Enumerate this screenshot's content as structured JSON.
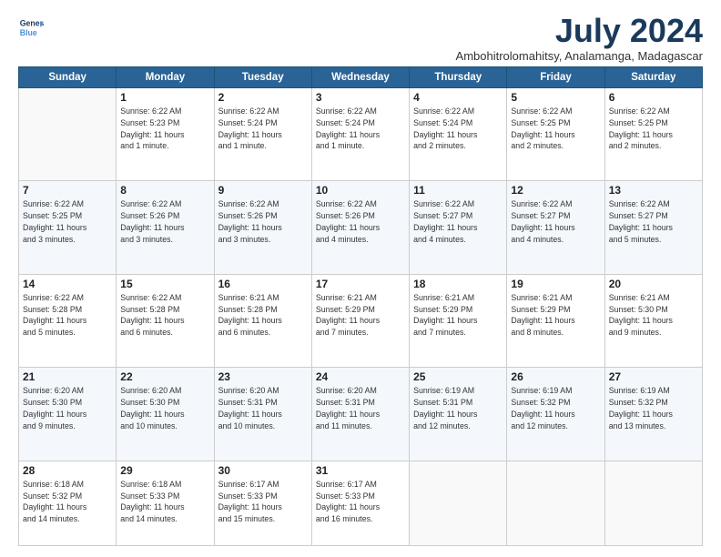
{
  "logo": {
    "line1": "General",
    "line2": "Blue",
    "icon": "▶"
  },
  "title": "July 2024",
  "location": "Ambohitrolomahitsy, Analamanga, Madagascar",
  "days_header": [
    "Sunday",
    "Monday",
    "Tuesday",
    "Wednesday",
    "Thursday",
    "Friday",
    "Saturday"
  ],
  "weeks": [
    [
      {
        "day": "",
        "detail": ""
      },
      {
        "day": "1",
        "detail": "Sunrise: 6:22 AM\nSunset: 5:23 PM\nDaylight: 11 hours\nand 1 minute."
      },
      {
        "day": "2",
        "detail": "Sunrise: 6:22 AM\nSunset: 5:24 PM\nDaylight: 11 hours\nand 1 minute."
      },
      {
        "day": "3",
        "detail": "Sunrise: 6:22 AM\nSunset: 5:24 PM\nDaylight: 11 hours\nand 1 minute."
      },
      {
        "day": "4",
        "detail": "Sunrise: 6:22 AM\nSunset: 5:24 PM\nDaylight: 11 hours\nand 2 minutes."
      },
      {
        "day": "5",
        "detail": "Sunrise: 6:22 AM\nSunset: 5:25 PM\nDaylight: 11 hours\nand 2 minutes."
      },
      {
        "day": "6",
        "detail": "Sunrise: 6:22 AM\nSunset: 5:25 PM\nDaylight: 11 hours\nand 2 minutes."
      }
    ],
    [
      {
        "day": "7",
        "detail": "Sunrise: 6:22 AM\nSunset: 5:25 PM\nDaylight: 11 hours\nand 3 minutes."
      },
      {
        "day": "8",
        "detail": "Sunrise: 6:22 AM\nSunset: 5:26 PM\nDaylight: 11 hours\nand 3 minutes."
      },
      {
        "day": "9",
        "detail": "Sunrise: 6:22 AM\nSunset: 5:26 PM\nDaylight: 11 hours\nand 3 minutes."
      },
      {
        "day": "10",
        "detail": "Sunrise: 6:22 AM\nSunset: 5:26 PM\nDaylight: 11 hours\nand 4 minutes."
      },
      {
        "day": "11",
        "detail": "Sunrise: 6:22 AM\nSunset: 5:27 PM\nDaylight: 11 hours\nand 4 minutes."
      },
      {
        "day": "12",
        "detail": "Sunrise: 6:22 AM\nSunset: 5:27 PM\nDaylight: 11 hours\nand 4 minutes."
      },
      {
        "day": "13",
        "detail": "Sunrise: 6:22 AM\nSunset: 5:27 PM\nDaylight: 11 hours\nand 5 minutes."
      }
    ],
    [
      {
        "day": "14",
        "detail": "Sunrise: 6:22 AM\nSunset: 5:28 PM\nDaylight: 11 hours\nand 5 minutes."
      },
      {
        "day": "15",
        "detail": "Sunrise: 6:22 AM\nSunset: 5:28 PM\nDaylight: 11 hours\nand 6 minutes."
      },
      {
        "day": "16",
        "detail": "Sunrise: 6:21 AM\nSunset: 5:28 PM\nDaylight: 11 hours\nand 6 minutes."
      },
      {
        "day": "17",
        "detail": "Sunrise: 6:21 AM\nSunset: 5:29 PM\nDaylight: 11 hours\nand 7 minutes."
      },
      {
        "day": "18",
        "detail": "Sunrise: 6:21 AM\nSunset: 5:29 PM\nDaylight: 11 hours\nand 7 minutes."
      },
      {
        "day": "19",
        "detail": "Sunrise: 6:21 AM\nSunset: 5:29 PM\nDaylight: 11 hours\nand 8 minutes."
      },
      {
        "day": "20",
        "detail": "Sunrise: 6:21 AM\nSunset: 5:30 PM\nDaylight: 11 hours\nand 9 minutes."
      }
    ],
    [
      {
        "day": "21",
        "detail": "Sunrise: 6:20 AM\nSunset: 5:30 PM\nDaylight: 11 hours\nand 9 minutes."
      },
      {
        "day": "22",
        "detail": "Sunrise: 6:20 AM\nSunset: 5:30 PM\nDaylight: 11 hours\nand 10 minutes."
      },
      {
        "day": "23",
        "detail": "Sunrise: 6:20 AM\nSunset: 5:31 PM\nDaylight: 11 hours\nand 10 minutes."
      },
      {
        "day": "24",
        "detail": "Sunrise: 6:20 AM\nSunset: 5:31 PM\nDaylight: 11 hours\nand 11 minutes."
      },
      {
        "day": "25",
        "detail": "Sunrise: 6:19 AM\nSunset: 5:31 PM\nDaylight: 11 hours\nand 12 minutes."
      },
      {
        "day": "26",
        "detail": "Sunrise: 6:19 AM\nSunset: 5:32 PM\nDaylight: 11 hours\nand 12 minutes."
      },
      {
        "day": "27",
        "detail": "Sunrise: 6:19 AM\nSunset: 5:32 PM\nDaylight: 11 hours\nand 13 minutes."
      }
    ],
    [
      {
        "day": "28",
        "detail": "Sunrise: 6:18 AM\nSunset: 5:32 PM\nDaylight: 11 hours\nand 14 minutes."
      },
      {
        "day": "29",
        "detail": "Sunrise: 6:18 AM\nSunset: 5:33 PM\nDaylight: 11 hours\nand 14 minutes."
      },
      {
        "day": "30",
        "detail": "Sunrise: 6:17 AM\nSunset: 5:33 PM\nDaylight: 11 hours\nand 15 minutes."
      },
      {
        "day": "31",
        "detail": "Sunrise: 6:17 AM\nSunset: 5:33 PM\nDaylight: 11 hours\nand 16 minutes."
      },
      {
        "day": "",
        "detail": ""
      },
      {
        "day": "",
        "detail": ""
      },
      {
        "day": "",
        "detail": ""
      }
    ]
  ]
}
